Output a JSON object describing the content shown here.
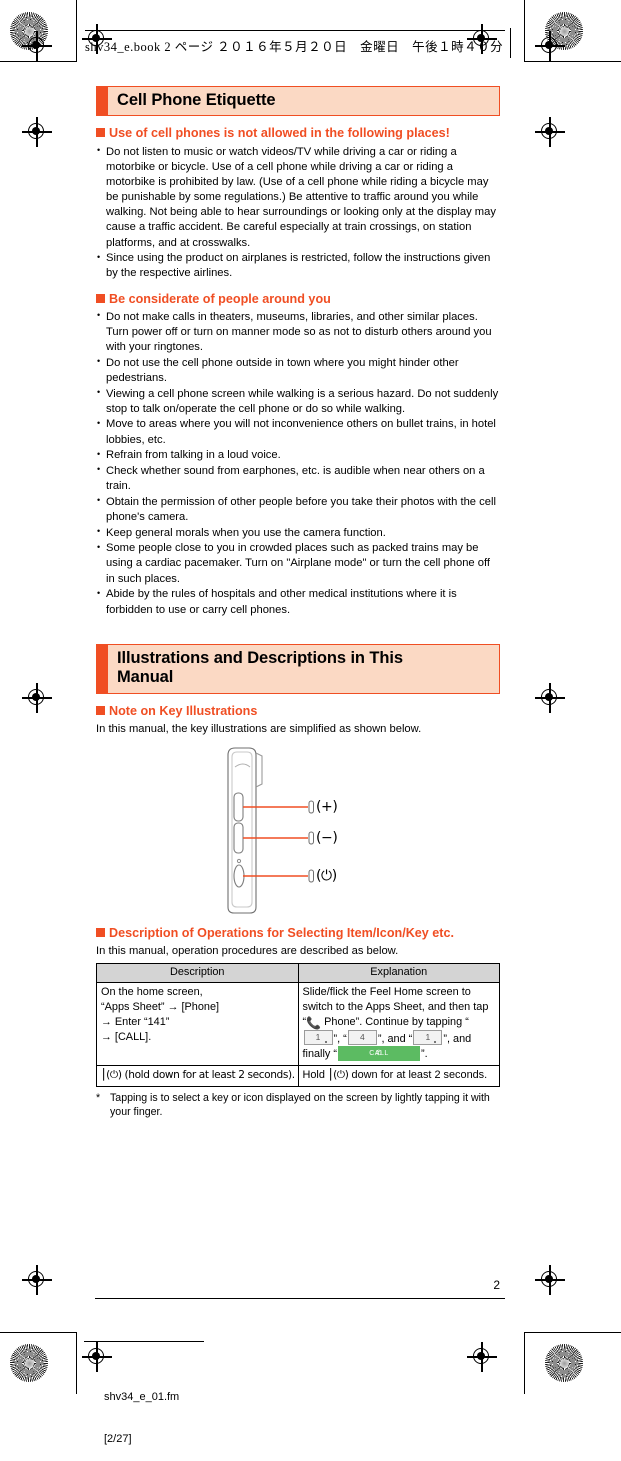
{
  "print_header": {
    "text": "shv34_e.book  2 ページ  ２０１６年５月２０日　金曜日　午後１時４０分"
  },
  "sections": [
    {
      "banner_title": "Cell Phone Etiquette",
      "subsections": [
        {
          "heading": "Use of cell phones is not allowed in the following places!",
          "bullets": [
            "Do not listen to music or watch videos/TV while driving a car or riding a motorbike or bicycle. Use of a cell phone while driving a car or riding a motorbike is prohibited by law. (Use of a cell phone while riding a bicycle may be punishable by some regulations.) Be attentive to traffic around you while walking. Not being able to hear surroundings or looking only at the display may cause a traffic accident. Be careful especially at train crossings, on station platforms, and at crosswalks.",
            "Since using the product on airplanes is restricted, follow the instructions given by the respective airlines."
          ]
        },
        {
          "heading": "Be considerate of people around you",
          "bullets": [
            "Do not make calls in theaters, museums, libraries, and other similar places. Turn power off or turn on manner mode so as not to disturb others around you with your ringtones.",
            "Do not use the cell phone outside in town where you might hinder other pedestrians.",
            "Viewing a cell phone screen while walking is a serious hazard. Do not suddenly stop to talk on/operate the cell phone or do so while walking.",
            "Move to areas where you will not inconvenience others on bullet trains, in hotel lobbies, etc.",
            "Refrain from talking in a loud voice.",
            "Check whether sound from earphones, etc. is audible when near others on a train.",
            "Obtain the permission of other people before you take their photos with the cell phone's camera.",
            "Keep general morals when you use the camera function.",
            "Some people close to you in crowded places such as packed trains may be using a cardiac pacemaker. Turn on \"Airplane mode\" or turn the cell phone off in such places.",
            "Abide by the rules of hospitals and other medical institutions where it is forbidden to use or carry cell phones."
          ]
        }
      ]
    }
  ],
  "section2": {
    "banner_title": "Illustrations and Descriptions in This Manual",
    "note_heading": "Note on Key Illustrations",
    "note_intro": "In this manual, the key illustrations are simplified as shown below.",
    "key_callouts": [
      {
        "label": "(+)",
        "name": "volume-up-key"
      },
      {
        "label": "(−)",
        "name": "volume-down-key"
      },
      {
        "label": "(⏻)",
        "name": "power-key"
      }
    ],
    "ops_heading": "Description of Operations for Selecting Item/Icon/Key etc.",
    "ops_intro": "In this manual, operation procedures are described as below."
  },
  "table": {
    "headers": [
      "Description",
      "Explanation"
    ],
    "rows": [
      {
        "description_lines": [
          "On the home screen,",
          "“Apps Sheet” → [Phone]",
          "→ Enter “141”",
          "→ [CALL]."
        ],
        "explanation_parts": {
          "p1": "Slide/flick the Feel Home screen to switch to the Apps Sheet, and then tap “",
          "p2": " Phone”. Continue by tapping “",
          "key1": "1",
          "p3": "”, “",
          "key2": "4",
          "p4": "”, and “",
          "key3": "1",
          "p5": "”, and finally “",
          "call_button_label": "CALL",
          "p6": "”."
        }
      },
      {
        "description_lines": [
          "(⏻) (hold down for at least 2 seconds)."
        ],
        "explanation_plain": "Hold  down for at least 2 seconds.",
        "explanation_prefix": "Hold ",
        "explanation_key": "(⏻)",
        "explanation_suffix": " down for at least 2 seconds."
      }
    ]
  },
  "footnote": {
    "marker": "*",
    "text": "Tapping is to select a key or icon displayed on the screen by lightly tapping it with your finger."
  },
  "footer": {
    "page_number": "2",
    "file_name": "shv34_e_01.fm",
    "file_page": "[2/27]"
  },
  "colors": {
    "accent_orange": "#f04e23",
    "banner_fill": "#fbd9c4",
    "table_header": "#d4d4d4",
    "call_green": "#5cbb62",
    "handset_blue": "#3d8fd6"
  }
}
